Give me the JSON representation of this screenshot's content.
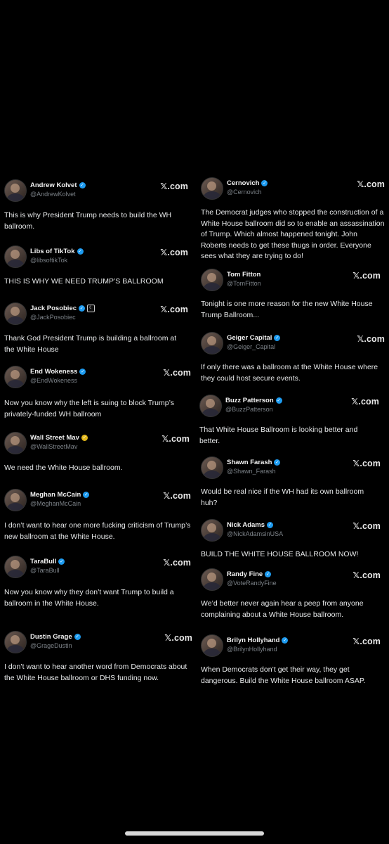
{
  "left_column": [
    {
      "name": "Andrew Kolvet",
      "handle": "@AndrewKolvet",
      "badge": "verified",
      "source": "𝕏.com",
      "text": "This is why President Trump needs to build the WH ballroom."
    },
    {
      "name": "Libs of TikTok",
      "handle": "@libsoftikTok",
      "badge": "verified",
      "source": "𝕏.com",
      "text": "THIS IS WHY WE NEED TRUMP’S BALLROOM"
    },
    {
      "name": "Jack Posobiec",
      "handle": "@JackPosobiec",
      "badge": "verified",
      "extra": "☾",
      "source": "𝕏.com",
      "text": "Thank God President Trump is building a ballroom at the White House"
    },
    {
      "name": "End Wokeness",
      "handle": "@EndWokeness",
      "badge": "verified",
      "source": "𝕏.com",
      "text": "Now you know why the left is suing to block Trump’s privately-funded WH ballroom"
    },
    {
      "name": "Wall Street Mav",
      "handle": "@WallStreetMav",
      "badge": "gold",
      "source": "𝕏.com",
      "text": "We need the White House ballroom."
    },
    {
      "name": "Meghan McCain",
      "handle": "@MeghanMcCain",
      "badge": "verified",
      "source": "𝕏.com",
      "text": "I don’t want to hear one more fucking criticism of Trump’s new ballroom at the White House."
    },
    {
      "name": "TaraBull",
      "handle": "@TaraBull",
      "badge": "verified",
      "source": "𝕏.com",
      "text": "Now you know why they don’t want Trump to build a ballroom in the White House."
    },
    {
      "name": "Dustin Grage",
      "handle": "@GrageDustin",
      "badge": "verified",
      "source": "𝕏.com",
      "text": "I don’t want to hear another word from Democrats about the White House ballroom or DHS funding now."
    }
  ],
  "right_column": [
    {
      "name": "Cernovich",
      "handle": "@Cernovich",
      "badge": "verified",
      "source": "𝕏.com",
      "text": "The Democrat judges who stopped the construction of a White House ballroom did so to enable an assassination of Trump. Which almost happened tonight. John Roberts needs to get these thugs in order. Everyone sees what they are trying to do!"
    },
    {
      "name": "Tom Fitton",
      "handle": "@TomFitton",
      "badge": "",
      "source": "𝕏.com",
      "text": "Tonight is one more reason for the new White House Trump Ballroom..."
    },
    {
      "name": "Geiger Capital",
      "handle": "@Geiger_Capital",
      "badge": "verified",
      "source": "𝕏.com",
      "text": "If only there was a ballroom at the White House where they could host secure events."
    },
    {
      "name": "Buzz Patterson",
      "handle": "@BuzzPatterson",
      "badge": "verified",
      "source": "𝕏.com",
      "text": "That White House Ballroom is looking better and better."
    },
    {
      "name": "Shawn Farash",
      "handle": "@Shawn_Farash",
      "badge": "verified",
      "source": "𝕏.com",
      "text": "Would be real nice if the WH had its own ballroom huh?"
    },
    {
      "name": "Nick Adams",
      "handle": "@NickAdamsinUSA",
      "badge": "verified",
      "source": "𝕏.com",
      "text": "BUILD THE WHITE HOUSE BALLROOM NOW!"
    },
    {
      "name": "Randy Fine",
      "handle": "@VoteRandyFine",
      "badge": "verified",
      "source": "𝕏.com",
      "text": "We’d better never again hear a peep from anyone complaining about a White House ballroom."
    },
    {
      "name": "Brilyn Hollyhand",
      "handle": "@BrilynHollyhand",
      "badge": "verified",
      "source": "𝕏.com",
      "text": "When Democrats don’t get their way, they get dangerous. Build the White House ballroom ASAP."
    }
  ],
  "colors": {
    "background": "#000000",
    "text": "#e7e9ea",
    "handle": "#7c8288",
    "verified": "#1d9bf0",
    "gold": "#e2b719"
  }
}
